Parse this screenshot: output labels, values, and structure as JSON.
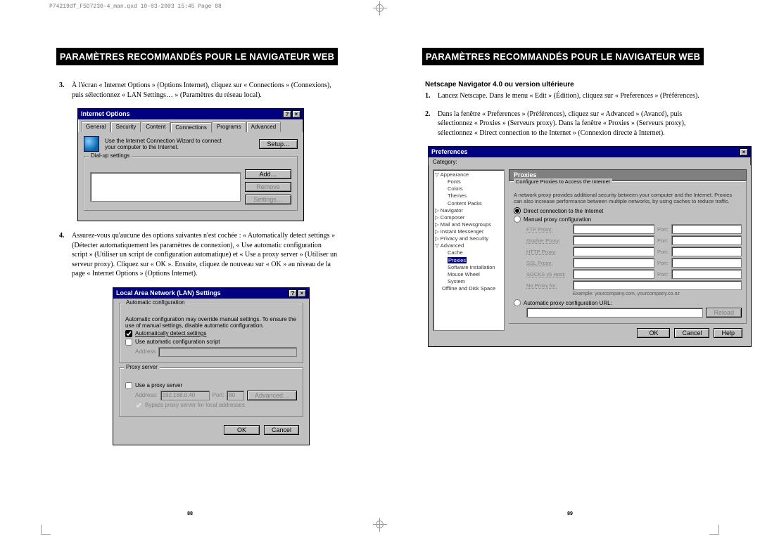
{
  "header": "P74219df_F5D7230-4_man.qxd  10-03-2003  15:45  Page 88",
  "title": "PARAMÈTRES RECOMMANDÉS POUR LE NAVIGATEUR WEB",
  "left": {
    "step3_num": "3.",
    "step3": "À l'écran « Internet Options » (Options Internet), cliquez sur « Connections » (Connexions), puis sélectionnez « LAN Settings… » (Paramètres du réseau local).",
    "step4_num": "4.",
    "step4": "Assurez-vous qu'aucune des options suivantes n'est cochée : « Automatically detect settings » (Détecter automatiquement les paramètres de connexion), « Use automatic configuration script » (Utiliser un script de configuration automatique) et « Use a proxy server » (Utiliser un serveur proxy). Cliquez sur « OK ». Ensuite, cliquez de nouveau sur « OK » au niveau de la page « Internet Options » (Options Internet).",
    "pagenum": "88"
  },
  "right": {
    "subhead": "Netscape Navigator 4.0 ou version ultérieure",
    "step1_num": "1.",
    "step1": "Lancez Netscape. Dans le menu « Edit » (Édition), cliquez sur « Preferences » (Préférences).",
    "step2_num": "2.",
    "step2": "Dans la fenêtre « Preferences » (Préférences), cliquez sur « Advanced » (Avancé), puis sélectionnez « Proxies » (Serveurs proxy). Dans la fenêtre « Proxies » (Serveurs proxy), sélectionnez « Direct connection to the Internet » (Connexion directe à Internet).",
    "pagenum": "89"
  },
  "io": {
    "title": "Internet Options",
    "tabs": [
      "General",
      "Security",
      "Content",
      "Connections",
      "Programs",
      "Advanced"
    ],
    "wizard": "Use the Internet Connection Wizard to connect your computer to the Internet.",
    "setup": "Setup…",
    "dialup_legend": "Dial-up settings",
    "add": "Add…",
    "remove": "Remove",
    "settings": "Settings…"
  },
  "lan": {
    "title": "Local Area Network (LAN) Settings",
    "auto_legend": "Automatic configuration",
    "auto_note": "Automatic configuration may override manual settings. To ensure the use of manual settings, disable automatic configuration.",
    "cb_detect": "Automatically detect settings",
    "cb_script": "Use automatic configuration script",
    "address": "Address",
    "proxy_legend": "Proxy server",
    "cb_proxy": "Use a proxy server",
    "addr_lbl": "Address:",
    "addr_val": "192.168.0.40",
    "port_lbl": "Port:",
    "port_val": "80",
    "adv": "Advanced…",
    "bypass": "Bypass proxy server for local addresses",
    "ok": "OK",
    "cancel": "Cancel"
  },
  "prefs": {
    "title": "Preferences",
    "cat": "Category:",
    "tree": {
      "appearance": "Appearance",
      "fonts": "Fonts",
      "colors": "Colors",
      "themes": "Themes",
      "content": "Content Packs",
      "navigator": "Navigator",
      "composer": "Composer",
      "mail": "Mail and Newsgroups",
      "im": "Instant Messenger",
      "priv": "Privacy and Security",
      "advanced": "Advanced",
      "cache": "Cache",
      "proxies": "Proxies",
      "sw": "Software Installation",
      "mouse": "Mouse Wheel",
      "system": "System",
      "offline": "Offline and Disk Space"
    },
    "section": "Proxies",
    "box_legend": "Configure Proxies to Access the Internet",
    "hint": "A network proxy provides additional security between your computer and the Internet. Proxies can also increase performance between multiple networks, by using caches to reduce traffic.",
    "r_direct": "Direct connection to the Internet",
    "r_manual": "Manual proxy configuration",
    "ftp": "FTP Proxy:",
    "gopher": "Gopher Proxy:",
    "http": "HTTP Proxy:",
    "ssl": "SSL Proxy:",
    "socks": "SOCKS v5 Host:",
    "noproxy": "No Proxy for:",
    "port": "Port:",
    "example": "Example: yourcompany.com, yourcompany.co.nz",
    "r_auto": "Automatic proxy configuration URL:",
    "reload": "Reload",
    "ok": "OK",
    "cancel": "Cancel",
    "help": "Help"
  }
}
